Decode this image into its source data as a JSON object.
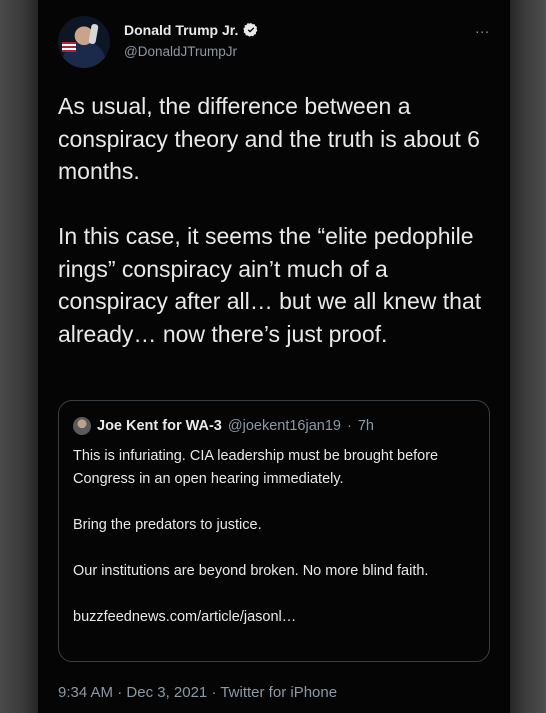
{
  "author": {
    "name": "Donald Trump Jr.",
    "handle": "@DonaldJTrumpJr",
    "verified": true,
    "avatar_icon": "profile-photo-icon"
  },
  "more_icon": "...",
  "tweet_text": "As usual, the difference between a conspiracy theory and the truth is about 6 months.\n\nIn this case, it seems the “elite pedophile rings” conspiracy ain’t much of a conspiracy after all… but we all knew that already… now there’s just proof.",
  "quoted": {
    "name": "Joe Kent for WA-3",
    "handle": "@joekent16jan19",
    "separator": "·",
    "time": "7h",
    "paragraphs": [
      "This is infuriating. CIA leadership must be brought before Congress in an open hearing immediately.",
      "Bring the predators to justice.",
      "Our institutions are beyond broken. No more blind faith.",
      "buzzfeednews.com/article/jasonl…"
    ]
  },
  "meta": {
    "time": "9:34 AM",
    "date": "Dec 3, 2021",
    "source": "Twitter for iPhone",
    "separator": " · "
  },
  "colors": {
    "background": "#050505",
    "text": "#e7e9ea",
    "secondary": "#8b98a5",
    "verified": "#1d9bf0"
  }
}
